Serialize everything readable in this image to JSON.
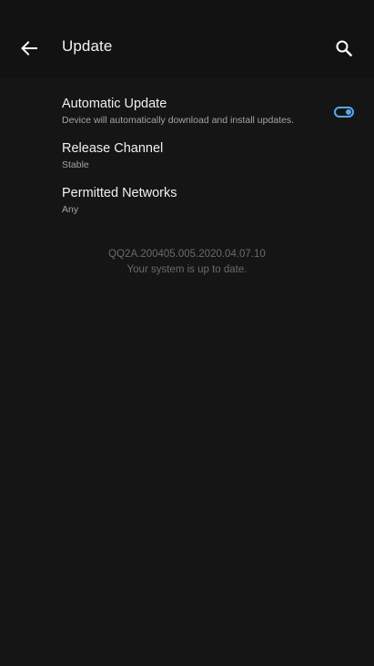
{
  "header": {
    "title": "Update",
    "back_icon": "arrow-back-icon",
    "search_icon": "search-icon"
  },
  "settings": {
    "items": [
      {
        "title": "Automatic Update",
        "summary": "Device will automatically download and install updates.",
        "toggle_on": true
      },
      {
        "title": "Release Channel",
        "summary": "Stable"
      },
      {
        "title": "Permitted Networks",
        "summary": "Any"
      }
    ]
  },
  "status": {
    "build": "QQ2A.200405.005.2020.04.07.10",
    "message": "Your system is up to date."
  },
  "colors": {
    "background": "#141414",
    "accent": "#5aa8f0"
  }
}
